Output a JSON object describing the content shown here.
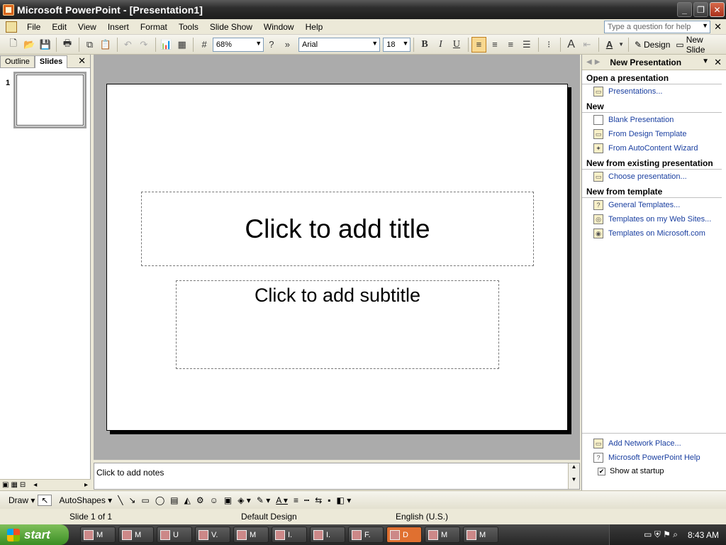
{
  "window": {
    "title": "Microsoft PowerPoint - [Presentation1]"
  },
  "menu": {
    "items": [
      "File",
      "Edit",
      "View",
      "Insert",
      "Format",
      "Tools",
      "Slide Show",
      "Window",
      "Help"
    ],
    "help_placeholder": "Type a question for help"
  },
  "toolbar": {
    "zoom": "68%",
    "font": "Arial",
    "size": "18",
    "bold": "B",
    "italic": "I",
    "underline": "U",
    "design_label": "Design",
    "new_slide_label": "New Slide"
  },
  "left_pane": {
    "tabs": [
      "Outline",
      "Slides"
    ],
    "slide_number": "1"
  },
  "slide": {
    "title_placeholder": "Click to add title",
    "subtitle_placeholder": "Click to add subtitle"
  },
  "notes": {
    "placeholder": "Click to add notes"
  },
  "task_pane": {
    "title": "New Presentation",
    "sections": {
      "open": {
        "heading": "Open a presentation",
        "links": [
          "Presentations..."
        ]
      },
      "new": {
        "heading": "New",
        "links": [
          "Blank Presentation",
          "From Design Template",
          "From AutoContent Wizard"
        ]
      },
      "existing": {
        "heading": "New from existing presentation",
        "links": [
          "Choose presentation..."
        ]
      },
      "template": {
        "heading": "New from template",
        "links": [
          "General Templates...",
          "Templates on my Web Sites...",
          "Templates on Microsoft.com"
        ]
      }
    },
    "bottom_links": [
      "Add Network Place...",
      "Microsoft PowerPoint Help"
    ],
    "show_at_startup": "Show at startup"
  },
  "drawbar": {
    "draw": "Draw",
    "autoshapes": "AutoShapes"
  },
  "status": {
    "slide": "Slide 1 of 1",
    "design": "Default Design",
    "language": "English (U.S.)"
  },
  "taskbar": {
    "start": "start",
    "tasks": [
      "M",
      "M",
      "U",
      "V.",
      "M",
      "I.",
      "I.",
      "F.",
      "D",
      "M",
      "M"
    ],
    "clock": "8:43 AM"
  }
}
